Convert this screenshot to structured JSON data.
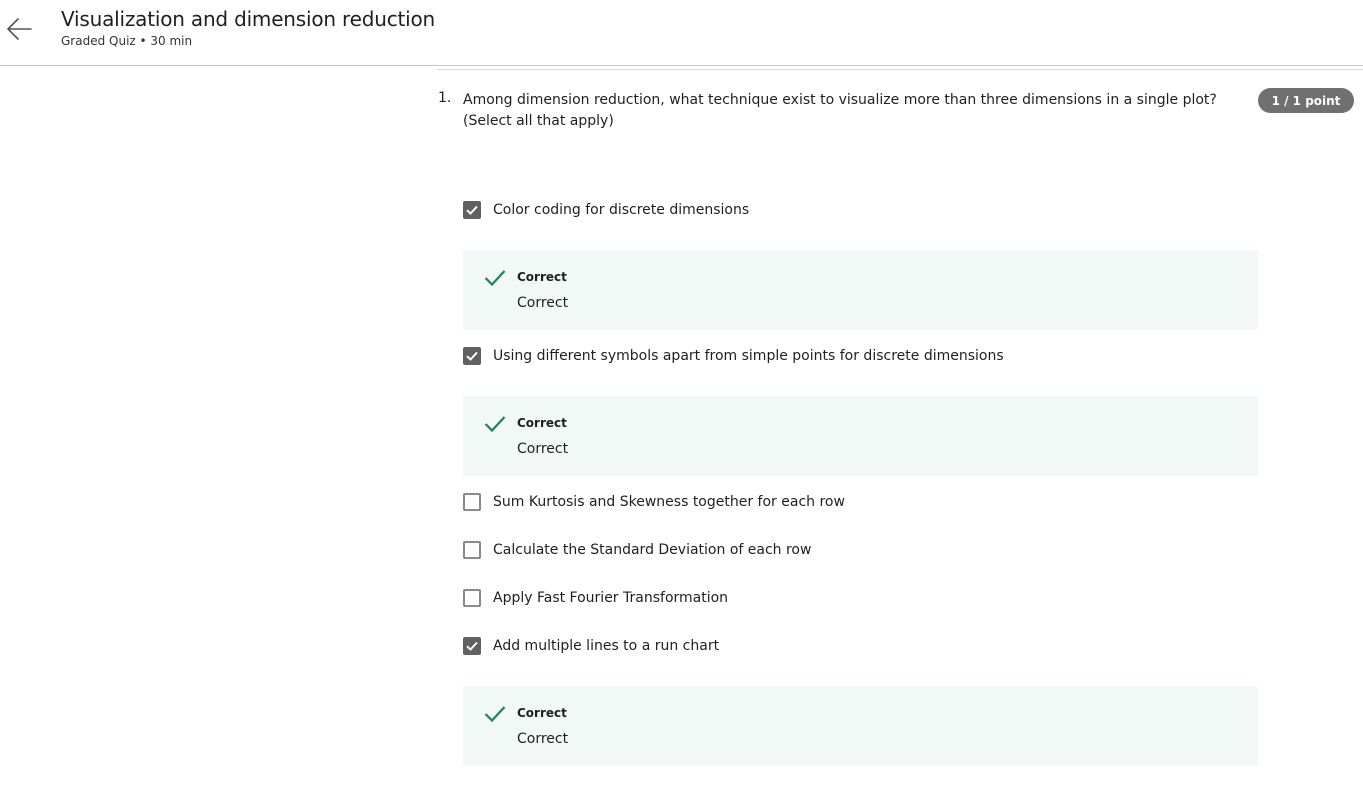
{
  "header": {
    "title": "Visualization and dimension reduction",
    "subtitle": "Graded Quiz • 30 min"
  },
  "question": {
    "number": "1.",
    "text": "Among dimension reduction, what technique exist to visualize more than three dimensions in a single plot? (Select all that apply)",
    "points": "1 / 1 point"
  },
  "options": [
    {
      "label": "Color coding for discrete dimensions",
      "checked": true
    },
    {
      "label": "Using different symbols apart from simple points for discrete dimensions",
      "checked": true
    },
    {
      "label": "Sum Kurtosis and Skewness together for each row",
      "checked": false
    },
    {
      "label": "Calculate the Standard Deviation of each row",
      "checked": false
    },
    {
      "label": "Apply Fast Fourier Transformation",
      "checked": false
    },
    {
      "label": "Add multiple lines to a run chart",
      "checked": true
    }
  ],
  "feedback": [
    {
      "title": "Correct",
      "text": "Correct"
    },
    {
      "title": "Correct",
      "text": "Correct"
    },
    {
      "title": "Correct",
      "text": "Correct"
    }
  ],
  "colors": {
    "correct_green": "#1f8354",
    "feedback_bg": "#f2f8f6",
    "badge_bg": "#707070",
    "checkbox_checked": "#616161"
  }
}
